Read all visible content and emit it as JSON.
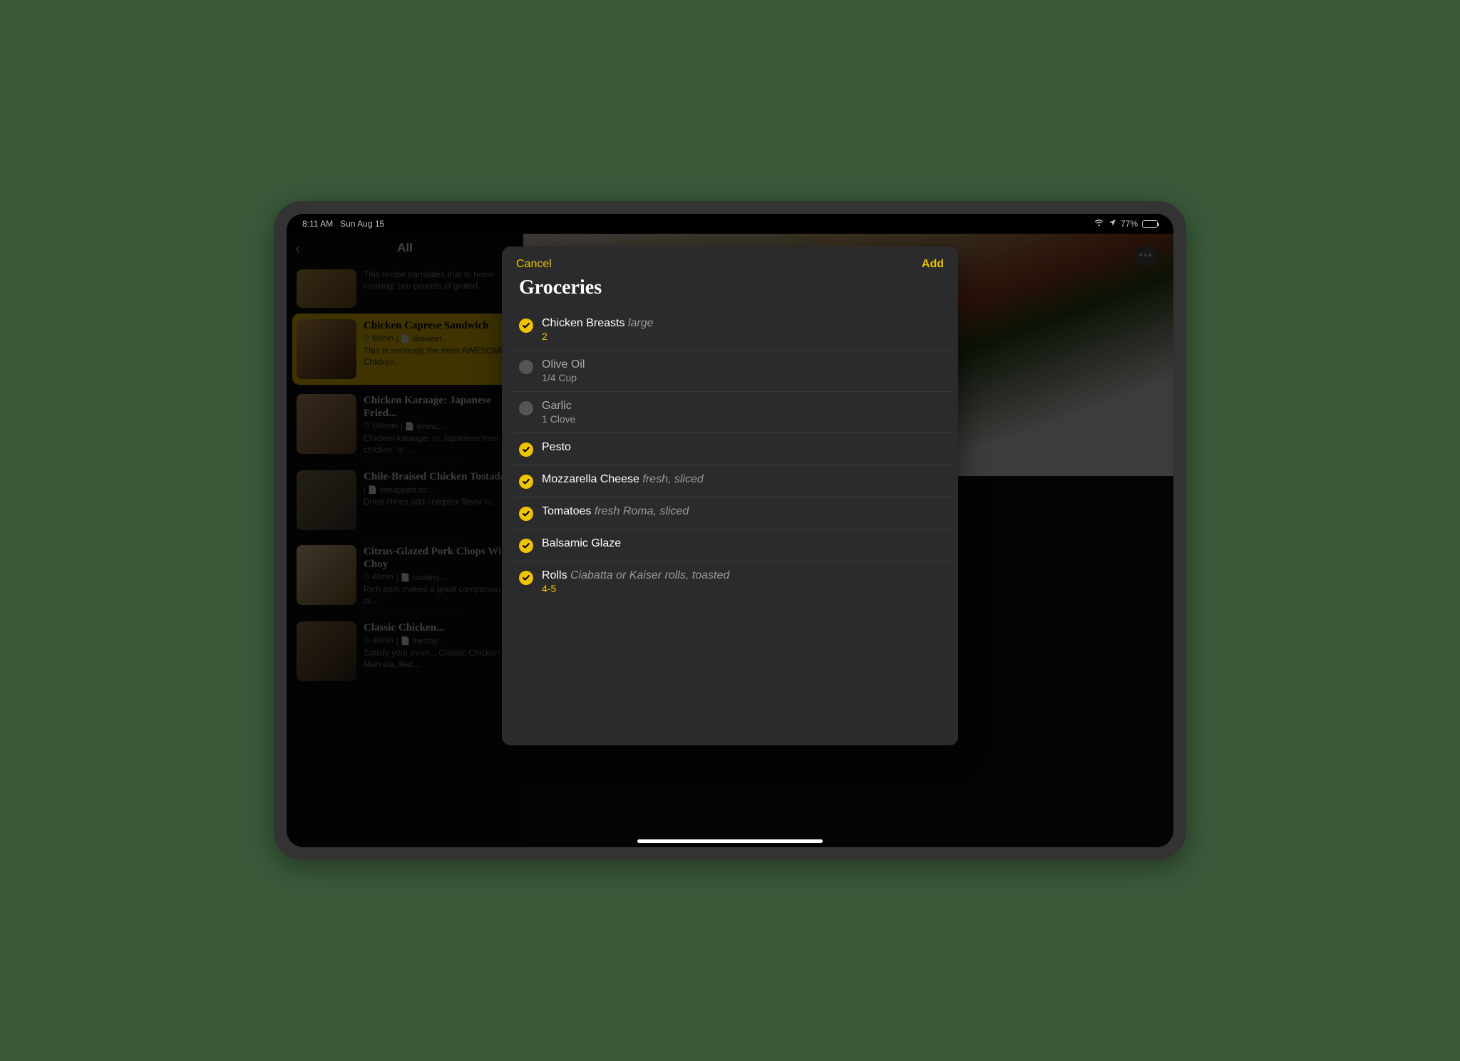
{
  "status": {
    "time": "8:11 AM",
    "date": "Sun Aug 15",
    "battery": "77%"
  },
  "sidebar": {
    "title": "All",
    "items": [
      {
        "title": "",
        "time": "",
        "source": "",
        "desc": "This recipe translates that to home cooking: two pounds of grated..."
      },
      {
        "title": "Chicken Caprese Sandwich",
        "time": "50min",
        "source": "ohsweet...",
        "desc": "This is seriously the most AWESOME Chicken..."
      },
      {
        "title": "Chicken Karaage: Japanese Fried...",
        "time": "100min",
        "source": "leitesc...",
        "desc": "Chicken karaage, or Japanese fried chicken, is ..."
      },
      {
        "title": "Chile-Braised Chicken Tostadas",
        "time": "",
        "source": "bonappetit.co...",
        "desc": "Dried chiles add complex flavor to..."
      },
      {
        "title": "Citrus-Glazed Pork Chops With Choy",
        "time": "40min",
        "source": "cooking...",
        "desc": "Rich pork makes a great companion to ta..."
      },
      {
        "title": "Classic Chicken...",
        "time": "30min",
        "source": "thestay...",
        "desc": "Satisfy your inner... Classic Chicken Marsala, feat..."
      }
    ]
  },
  "detail": {
    "ingredients": [
      {
        "qty": "2",
        "name": "Chicken Breasts",
        "note": "large"
      },
      {
        "qty": "1/4 Cup",
        "name": "Olive Oil",
        "note": ""
      },
      {
        "qty": "1 Clove",
        "name": "Garlic",
        "note": ""
      },
      {
        "qty": "",
        "name": "Pesto",
        "note": ""
      },
      {
        "qty": "",
        "name": "Mozzarella Cheese",
        "note": "fresh, sliced"
      },
      {
        "qty": "",
        "name": "Tomatoes",
        "note": "fresh Roma, sliced"
      },
      {
        "qty": "",
        "name": "Balsamic Glaze",
        "note": ""
      }
    ]
  },
  "modal": {
    "cancel": "Cancel",
    "add": "Add",
    "title": "Groceries",
    "items": [
      {
        "checked": true,
        "name": "Chicken Breasts",
        "note": "large",
        "sub": "2"
      },
      {
        "checked": false,
        "name": "Olive Oil",
        "note": "",
        "sub": "1/4 Cup"
      },
      {
        "checked": false,
        "name": "Garlic",
        "note": "",
        "sub": "1 Clove"
      },
      {
        "checked": true,
        "name": "Pesto",
        "note": "",
        "sub": ""
      },
      {
        "checked": true,
        "name": "Mozzarella Cheese",
        "note": "fresh, sliced",
        "sub": ""
      },
      {
        "checked": true,
        "name": "Tomatoes",
        "note": "fresh Roma, sliced",
        "sub": ""
      },
      {
        "checked": true,
        "name": "Balsamic Glaze",
        "note": "",
        "sub": ""
      },
      {
        "checked": true,
        "name": "Rolls",
        "note": "Ciabatta or Kaiser rolls, toasted",
        "sub": "4-5"
      }
    ]
  }
}
